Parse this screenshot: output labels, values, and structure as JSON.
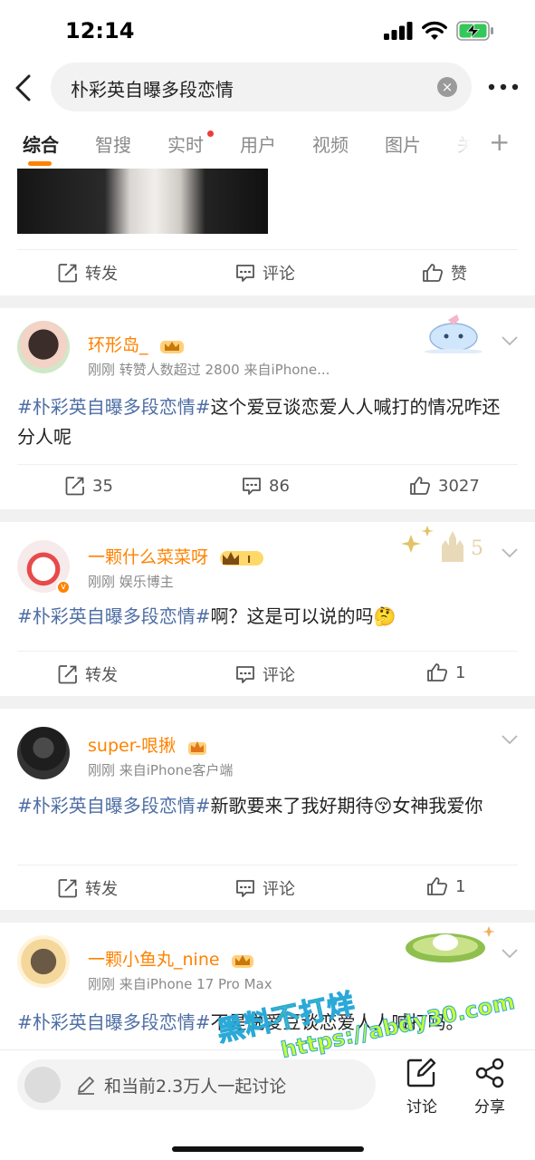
{
  "status": {
    "time": "12:14"
  },
  "search": {
    "query": "朴彩英自曝多段恋情",
    "clear": "×"
  },
  "tabs": [
    {
      "label": "综合"
    },
    {
      "label": "智搜"
    },
    {
      "label": "实时"
    },
    {
      "label": "用户"
    },
    {
      "label": "视频"
    },
    {
      "label": "图片"
    },
    {
      "label": "关"
    }
  ],
  "actions": {
    "repost": "转发",
    "comment": "评论",
    "like": "赞"
  },
  "posts": [
    {
      "username": "环形岛_",
      "meta": "刚刚 转赞人数超过 2800  来自iPhone...",
      "hashtag": "#朴彩英自曝多段恋情#",
      "text": "这个爱豆谈恋爱人人喊打的情况咋还分人呢",
      "reposts": "35",
      "comments": "86",
      "likes": "3027"
    },
    {
      "username": "一颗什么菜菜呀",
      "meta": "刚刚  娱乐博主",
      "hashtag": "#朴彩英自曝多段恋情#",
      "text": "啊？这是可以说的吗🤔",
      "likes": "1"
    },
    {
      "username": "super-哏揪",
      "meta": "刚刚  来自iPhone客户端",
      "hashtag": "#朴彩英自曝多段恋情#",
      "text": "新歌要来了我好期待😚女神我爱你",
      "likes": "1"
    },
    {
      "username": "一颗小鱼丸_nine",
      "meta": "刚刚  来自iPhone 17 Pro Max",
      "hashtag": "#朴彩英自曝多段恋情#",
      "text": "不是说爱豆谈恋爱人人喊打吗。"
    }
  ],
  "bottom": {
    "placeholder": "和当前2.3万人一起讨论",
    "discuss": "讨论",
    "share": "分享"
  },
  "watermark": {
    "line1": "黑料不打烊",
    "line2": "https://abdy30.com"
  },
  "colors": {
    "accent": "#ff8200",
    "hashtag": "#4e6ea5",
    "username": "#ff8200"
  }
}
